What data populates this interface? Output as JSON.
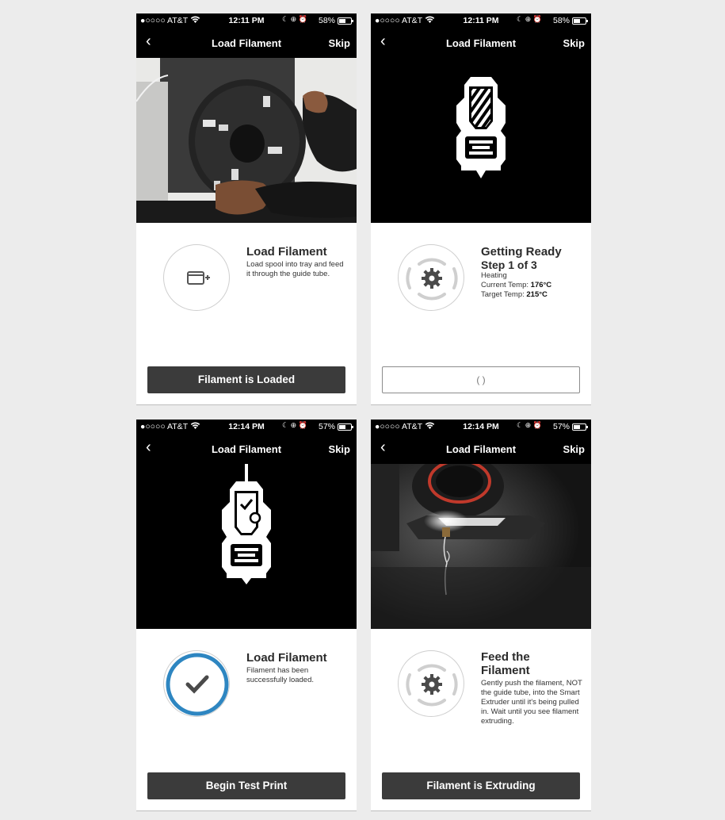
{
  "screens": [
    {
      "status": {
        "carrier": "●○○○○ AT&T",
        "time": "12:11 PM",
        "battery": "58%",
        "battery_level": 0.58
      },
      "nav": {
        "back": "‹",
        "title": "Load Filament",
        "skip": "Skip"
      },
      "title": "Load Filament",
      "description": "Load spool into tray and feed it through the guide tube.",
      "button": "Filament is Loaded"
    },
    {
      "status": {
        "carrier": "●○○○○ AT&T",
        "time": "12:11 PM",
        "battery": "58%",
        "battery_level": 0.58
      },
      "nav": {
        "back": "‹",
        "title": "Load Filament",
        "skip": "Skip"
      },
      "title": "Getting Ready",
      "subtitle": "Step 1 of 3",
      "status_line": "Heating",
      "current_temp_label": "Current Temp:",
      "current_temp": "176°C",
      "target_temp_label": "Target Temp:",
      "target_temp": "215°C",
      "button": "( )"
    },
    {
      "status": {
        "carrier": "●○○○○ AT&T",
        "time": "12:14 PM",
        "battery": "57%",
        "battery_level": 0.57
      },
      "nav": {
        "back": "‹",
        "title": "Load Filament",
        "skip": "Skip"
      },
      "title": "Load Filament",
      "description": "Filament has been successfully loaded.",
      "button": "Begin Test Print"
    },
    {
      "status": {
        "carrier": "●○○○○ AT&T",
        "time": "12:14 PM",
        "battery": "57%",
        "battery_level": 0.57
      },
      "nav": {
        "back": "‹",
        "title": "Load Filament",
        "skip": "Skip"
      },
      "title": "Feed the Filament",
      "description": "Gently push the filament, NOT the guide tube, into the Smart Extruder until it's being pulled in. Wait until you see filament extruding.",
      "button": "Filament is Extruding"
    }
  ],
  "colors": {
    "accent": "#2e86c1",
    "button": "#3b3b3b",
    "nav": "#000000"
  },
  "icons": [
    "wifi-icon",
    "moon-icon",
    "lock-rotation-icon",
    "alarm-icon",
    "battery-icon",
    "back-chevron-icon",
    "tray-plus-icon",
    "gear-icon",
    "checkmark-icon",
    "extruder-icon"
  ]
}
